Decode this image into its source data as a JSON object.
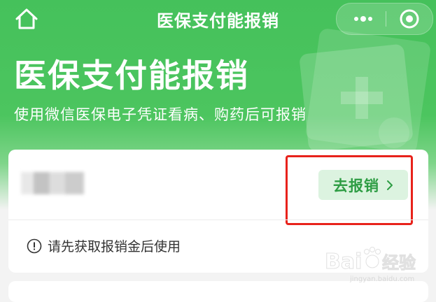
{
  "nav": {
    "title": "医保支付能报销",
    "home_icon": "home-icon",
    "more_icon": "more-dots-icon",
    "close_icon": "close-circle-icon"
  },
  "hero": {
    "title": "医保支付能报销",
    "subtitle": "使用微信医保电子凭证看病、购药后可报销"
  },
  "card": {
    "button_label": "去报销",
    "notice": "请先获取报销金后使用"
  },
  "watermark": {
    "brand": "Bai",
    "brand_suffix": "经验",
    "url": "jingyan.baidu.com"
  },
  "colors": {
    "accent": "#4cc55f",
    "button_bg": "#dcf3e0",
    "button_text": "#2e9d44",
    "highlight": "#e8221b"
  }
}
